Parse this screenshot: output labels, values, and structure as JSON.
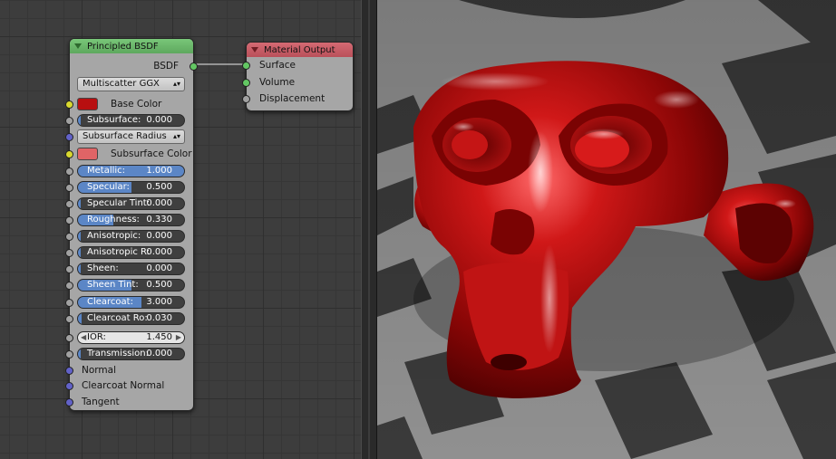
{
  "principled": {
    "title": "Principled BSDF",
    "output_label": "BSDF",
    "distribution": "Multiscatter GGX",
    "base_color_label": "Base Color",
    "base_color": "#b80f10",
    "subsurface_label": "Subsurface:",
    "subsurface_value": "0.000",
    "subsurface_radius": "Subsurface Radius",
    "subsurface_color_label": "Subsurface Color",
    "subsurface_color": "#e06466",
    "params": [
      {
        "label": "Metallic:",
        "value": "1.000",
        "fill": 1.0
      },
      {
        "label": "Specular:",
        "value": "0.500",
        "fill": 0.5
      },
      {
        "label": "Specular Tint:",
        "value": "0.000",
        "fill": 0.0
      },
      {
        "label": "Roughness:",
        "value": "0.330",
        "fill": 0.33
      },
      {
        "label": "Anisotropic:",
        "value": "0.000",
        "fill": 0.0
      },
      {
        "label": "Anisotropic R:",
        "value": "0.000",
        "fill": 0.0
      },
      {
        "label": "Sheen:",
        "value": "0.000",
        "fill": 0.0
      },
      {
        "label": "Sheen Tint:",
        "value": "0.500",
        "fill": 0.5
      },
      {
        "label": "Clearcoat:",
        "value": "3.000",
        "fill": 0.6
      },
      {
        "label": "Clearcoat Ro:",
        "value": "0.030",
        "fill": 0.03
      }
    ],
    "ior_label": "IOR:",
    "ior_value": "1.450",
    "transmission_label": "Transmission:",
    "transmission_value": "0.000",
    "normal_label": "Normal",
    "clearcoat_normal_label": "Clearcoat Normal",
    "tangent_label": "Tangent"
  },
  "material_output": {
    "title": "Material Output",
    "inputs": [
      "Surface",
      "Volume",
      "Displacement"
    ]
  },
  "colors": {
    "node_body": "#a6a6a6",
    "slider_fill": "#5b86c6",
    "link": "#b5b5b5"
  }
}
